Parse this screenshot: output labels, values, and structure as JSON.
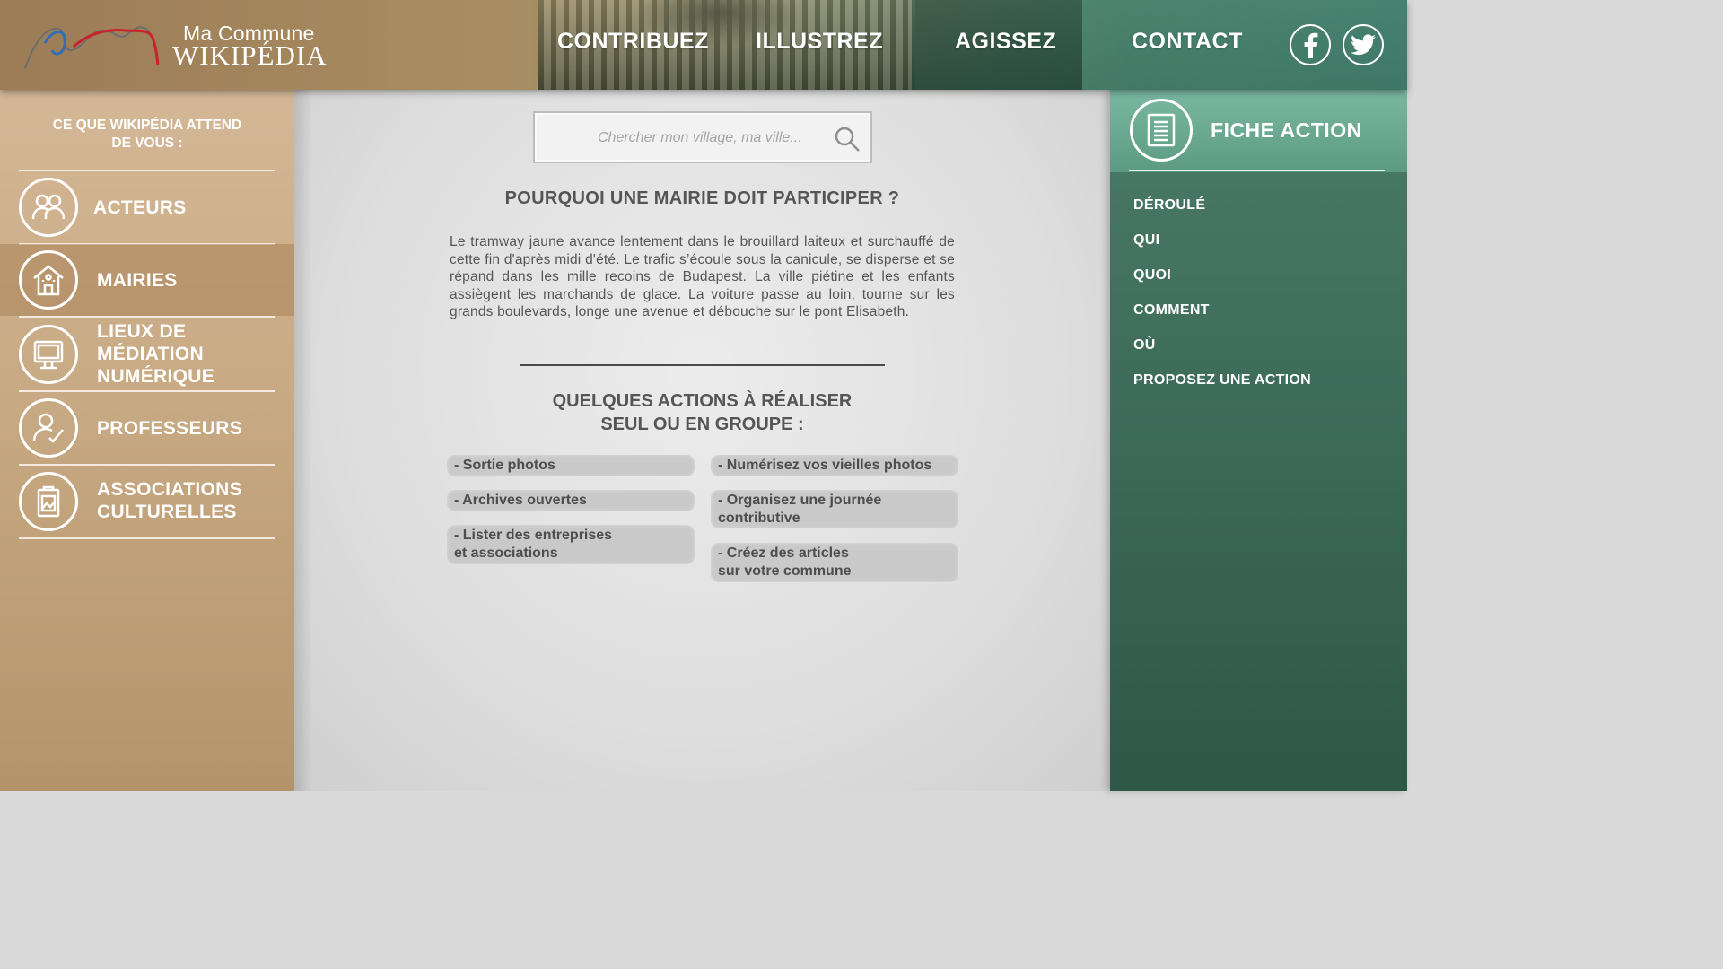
{
  "header": {
    "logo_top": "Ma Commune",
    "logo_bottom": "WIKIPÉDIA",
    "nav": [
      {
        "label": "CONTRIBUEZ"
      },
      {
        "label": "ILLUSTREZ"
      },
      {
        "label": "AGISSEZ"
      },
      {
        "label": "CONTACT"
      }
    ],
    "social": [
      {
        "icon": "facebook-icon"
      },
      {
        "icon": "twitter-icon"
      }
    ]
  },
  "sidebar": {
    "title": "CE QUE WIKIPÉDIA ATTEND\nDE VOUS :",
    "items": [
      {
        "label": "ACTEURS",
        "icon": "group-icon",
        "active": false
      },
      {
        "label": "MAIRIES",
        "icon": "town-hall-icon",
        "active": true
      },
      {
        "label": "LIEUX DE\nMÉDIATION\nNUMÉRIQUE",
        "icon": "monitor-icon",
        "active": false
      },
      {
        "label": "PROFESSEURS",
        "icon": "teacher-icon",
        "active": false
      },
      {
        "label": "ASSOCIATIONS\nCULTURELLES",
        "icon": "clipboard-image-icon",
        "active": false
      }
    ]
  },
  "main": {
    "search_placeholder": "Chercher mon village, ma ville...",
    "title": "POURQUOI UNE MAIRIE DOIT PARTICIPER ?",
    "text": "Le tramway jaune avance lentement dans le brouillard laiteux et surchauffé de cette fin d'après midi d'été. Le trafic s’écoule sous la canicule, se disperse et se répand dans les mille recoins de Budapest. La ville piétine et les enfants assiègent les marchands de glace. La voiture passe au loin, tourne sur les grands boulevards, longe une avenue et débouche sur le pont Elisabeth.",
    "actions_title": "QUELQUES ACTIONS À RÉALISER\nSEUL OU EN GROUPE :",
    "actions_left": [
      {
        "label": "- Sortie photos"
      },
      {
        "label": "- Archives ouvertes"
      },
      {
        "label": "- Lister des entreprises\net associations"
      }
    ],
    "actions_right": [
      {
        "label": "- Numérisez vos vieilles photos"
      },
      {
        "label": "- Organisez une journée\ncontributive"
      },
      {
        "label": "- Créez des articles\nsur votre commune"
      }
    ]
  },
  "right_panel": {
    "title": "FICHE ACTION",
    "links": [
      {
        "label": "DÉROULÉ"
      },
      {
        "label": "QUI"
      },
      {
        "label": "QUOI"
      },
      {
        "label": "COMMENT"
      },
      {
        "label": "OÙ"
      },
      {
        "label": "PROPOSEZ UNE ACTION"
      }
    ]
  }
}
